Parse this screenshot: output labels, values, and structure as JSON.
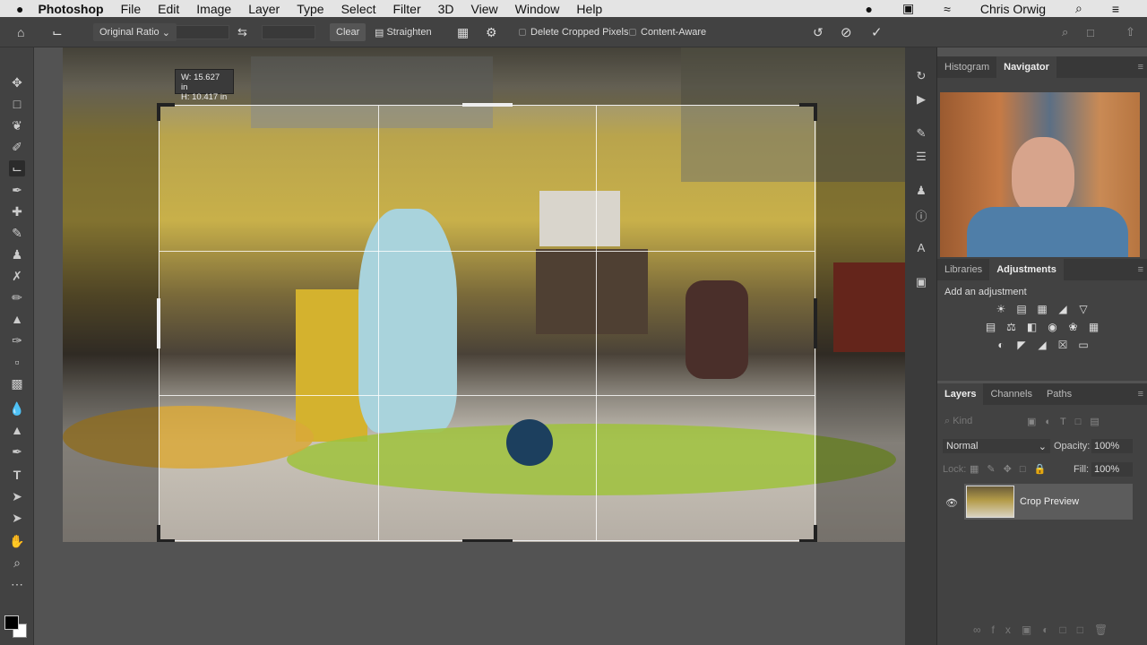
{
  "menubar": {
    "app": "Photoshop",
    "items": [
      "File",
      "Edit",
      "Image",
      "Layer",
      "Type",
      "Select",
      "Filter",
      "3D",
      "View",
      "Window",
      "Help"
    ],
    "user": "Chris Orwig"
  },
  "options": {
    "ratio": "Original Ratio",
    "width_value": "",
    "height_value": "",
    "clear": "Clear",
    "straighten": "Straighten",
    "delete_cropped": "Delete Cropped Pixels",
    "content_aware": "Content-Aware"
  },
  "crop_info": {
    "w": "W: 15.627 in",
    "h": "H: 10.417 in"
  },
  "panels": {
    "top_tabs": [
      "Histogram",
      "Navigator"
    ],
    "mid_tabs": [
      "Libraries",
      "Adjustments"
    ],
    "add_adjustment": "Add an adjustment",
    "layer_tabs": [
      "Layers",
      "Channels",
      "Paths"
    ],
    "kind": "Kind",
    "blend": "Normal",
    "opacity_label": "Opacity:",
    "opacity": "100%",
    "lock_label": "Lock:",
    "fill_label": "Fill:",
    "fill": "100%",
    "layers": [
      {
        "name": "Crop Preview",
        "visible": true
      }
    ]
  },
  "colors": {
    "accent": "#9fc23c",
    "panel": "#424242"
  }
}
